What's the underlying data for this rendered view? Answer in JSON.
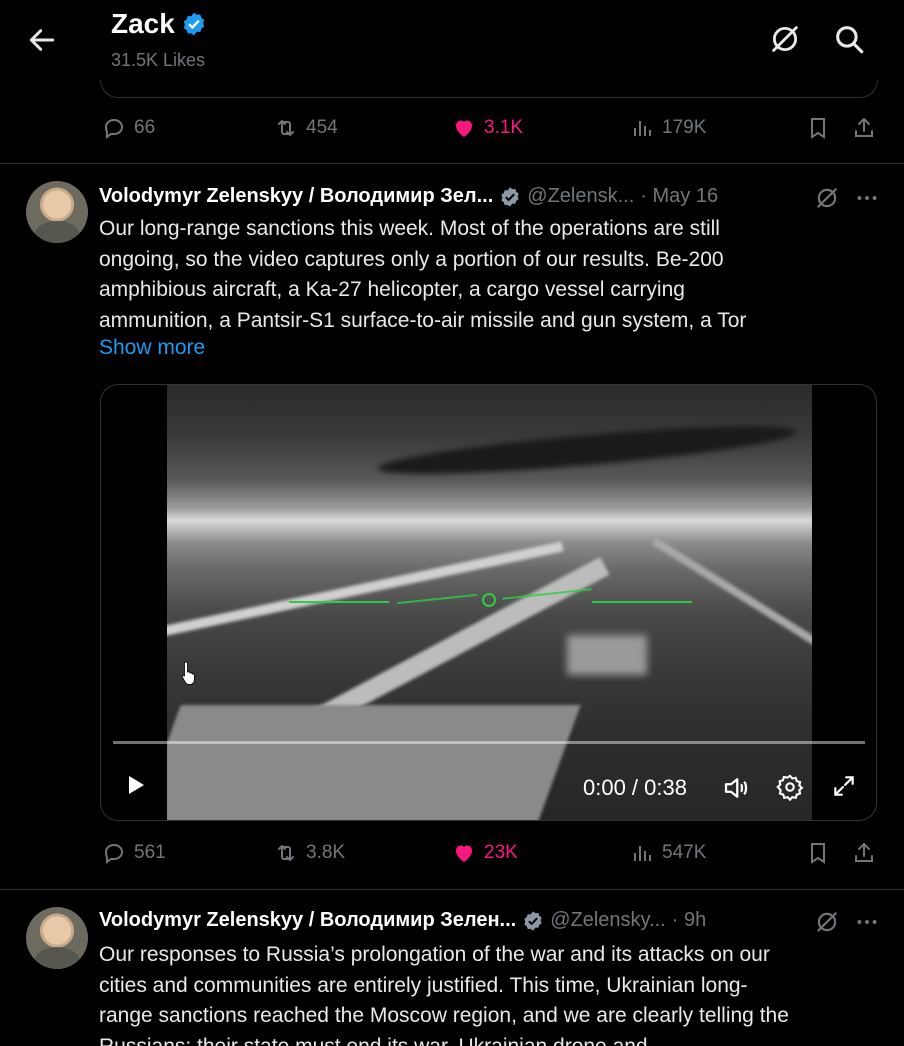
{
  "header": {
    "title": "Zack",
    "subtitle": "31.5K Likes"
  },
  "prev_tweet": {
    "replies": "66",
    "reposts": "454",
    "likes": "3.1K",
    "views": "179K"
  },
  "tweets": [
    {
      "author": "Volodymyr Zelenskyy / Володимир Зел...",
      "handle": "@Zelensk...",
      "time": "· May 16",
      "text_lines": [
        "Our long-range sanctions this week. Most of the operations are still",
        "ongoing, so the video captures only a portion of our results. Be-200",
        "amphibious aircraft, a Ka-27 helicopter, a cargo vessel carrying",
        "ammunition, a Pantsir-S1 surface-to-air missile and gun system, a Tor"
      ],
      "show_more": "Show more",
      "video": {
        "time_display": "0:00 / 0:38",
        "progress": 0
      },
      "replies": "561",
      "reposts": "3.8K",
      "likes": "23K",
      "views": "547K"
    },
    {
      "author": "Volodymyr Zelenskyy / Володимир Зелен...",
      "handle": "@Zelensky...",
      "time": "· 9h",
      "text_lines": [
        "Our responses to Russia’s prolongation of the war and its attacks on our",
        "cities and communities are entirely justified. This time, Ukrainian long-",
        "range sanctions reached the Moscow region, and we are clearly telling the",
        "Russians: their state must end its war. Ukrainian drone and"
      ]
    }
  ],
  "colors": {
    "background": "#000000",
    "text": "#e7e9ea",
    "muted": "#71767b",
    "accent": "#1d9bf0",
    "like": "#f91880",
    "hud": "#2ecc40"
  },
  "icons": [
    "back-arrow-icon",
    "verified-icon",
    "grok-icon",
    "search-icon",
    "reply-icon",
    "repost-icon",
    "heart-icon",
    "views-icon",
    "bookmark-icon",
    "share-icon",
    "more-icon",
    "play-icon",
    "volume-icon",
    "settings-icon",
    "fullscreen-icon",
    "cursor-icon"
  ]
}
